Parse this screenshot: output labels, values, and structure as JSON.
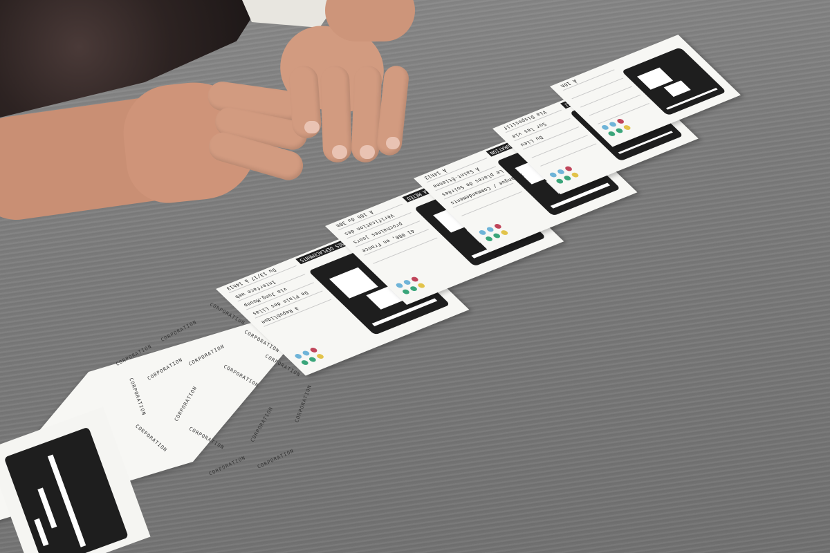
{
  "scene": {
    "colors": {
      "table": "#7b7b7b",
      "card": "#f7f7f4",
      "panel": "#1e1e1e",
      "green": "#3aa57a",
      "blue": "#6fb4d8",
      "red": "#c0455a",
      "yellow": "#e2c34a"
    }
  },
  "back_card": {
    "word": "CORPORATION"
  },
  "cards": [
    {
      "tag": "VÉRIFIER LES STATISTIQUES DE SES DÉPLACEMENTS",
      "line1": "Du 13/17 à 14h13",
      "line2": "Interface web",
      "line3": "via Jung.Mounp",
      "line4": "De Plain des Lilas",
      "line5": "à Republique"
    },
    {
      "tag": "VÉRIFIER LA MÉTÉO",
      "line1": "À 10h du 30h",
      "line2": "Vérification des",
      "line3": "prochaines jours",
      "line4": "41 000, en France",
      "line5": ""
    },
    {
      "tag": "APPELER UNE RESTAURATION",
      "line1": "À 14h13",
      "line2": "À Saint-Étienne",
      "line3": "Le places de Soirées",
      "line4": "1 Langue / Commandements",
      "line5": ""
    },
    {
      "tag": "PRENDRE UN TAXI",
      "line1": "Via Dispositif",
      "line2": "Sur les vie",
      "line3": "Du Lieu",
      "line4": "",
      "line5": ""
    },
    {
      "tag": "",
      "line1": "À 16h",
      "line2": "",
      "line3": "",
      "line4": "",
      "line5": ""
    }
  ]
}
